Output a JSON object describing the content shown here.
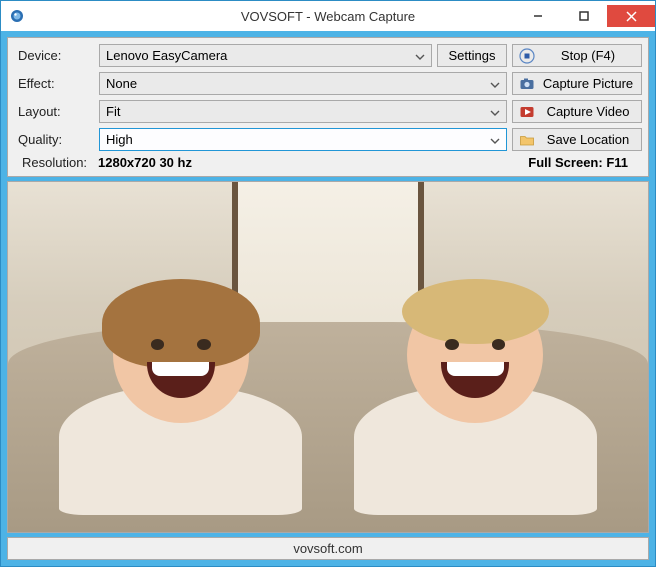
{
  "window": {
    "title": "VOVSOFT - Webcam Capture"
  },
  "labels": {
    "device": "Device:",
    "effect": "Effect:",
    "layout": "Layout:",
    "quality": "Quality:",
    "resolution": "Resolution:"
  },
  "values": {
    "device": "Lenovo EasyCamera",
    "effect": "None",
    "layout": "Fit",
    "quality": "High",
    "resolution": "1280x720 30 hz"
  },
  "buttons": {
    "settings": "Settings",
    "stop": "Stop (F4)",
    "capture_picture": "Capture Picture",
    "capture_video": "Capture Video",
    "save_location": "Save Location"
  },
  "status": {
    "fullscreen": "Full Screen: F11"
  },
  "footer": {
    "url": "vovsoft.com"
  }
}
